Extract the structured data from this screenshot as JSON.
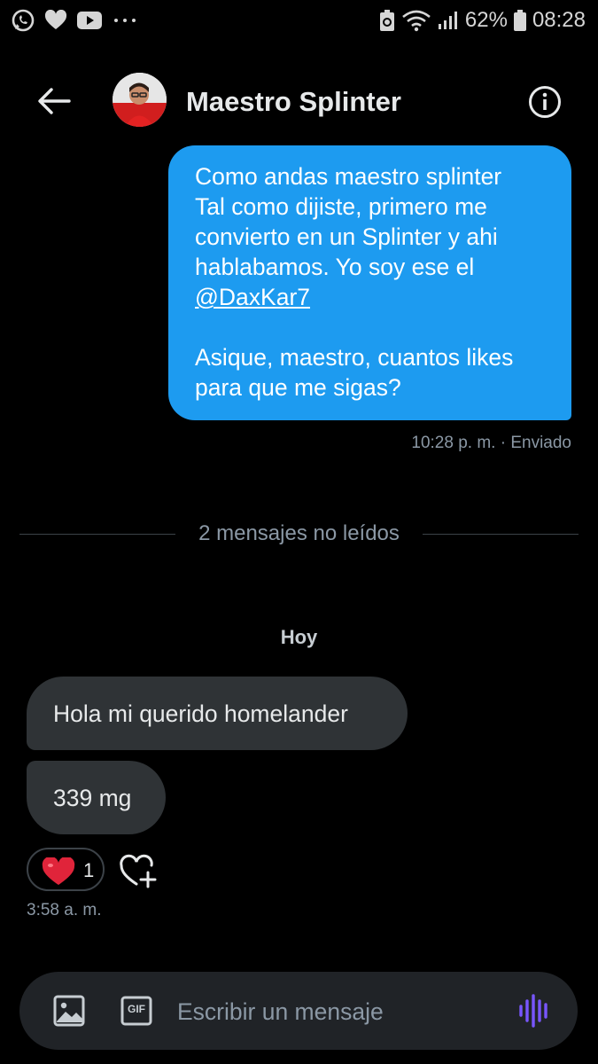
{
  "status_bar": {
    "battery_percent": "62%",
    "time": "08:28",
    "icons": [
      "whatsapp-icon",
      "heart-icon",
      "youtube-icon",
      "more-dots-icon",
      "battery-saver-icon",
      "wifi-icon",
      "signal-icon",
      "battery-icon"
    ]
  },
  "header": {
    "title": "Maestro Splinter",
    "back_icon": "arrow-left-icon",
    "info_icon": "info-icon"
  },
  "messages": {
    "outgoing": {
      "line1": "Como andas maestro splinter",
      "line2": "Tal como dijiste, primero me",
      "line3": "convierto en un Splinter y ahi",
      "line4": "hablabamos. Yo soy ese el",
      "mention": "@DaxKar7",
      "line5": "Asique, maestro, cuantos likes",
      "line6": "para que me sigas?",
      "meta": "10:28 p. m. · Enviado"
    },
    "unread_divider": "2 mensajes no leídos",
    "day_label": "Hoy",
    "incoming": [
      {
        "text": "Hola mi querido homelander"
      },
      {
        "text": "339 mg"
      }
    ],
    "reaction": {
      "emoji": "heart",
      "count": "1"
    },
    "incoming_time": "3:58 a. m."
  },
  "composer": {
    "placeholder": "Escribir un mensaje",
    "gif_label": "GIF"
  },
  "colors": {
    "accent": "#1d9bf0",
    "background": "#000000",
    "incoming_bubble": "#2f3336",
    "voice_accent": "#7856ff"
  }
}
